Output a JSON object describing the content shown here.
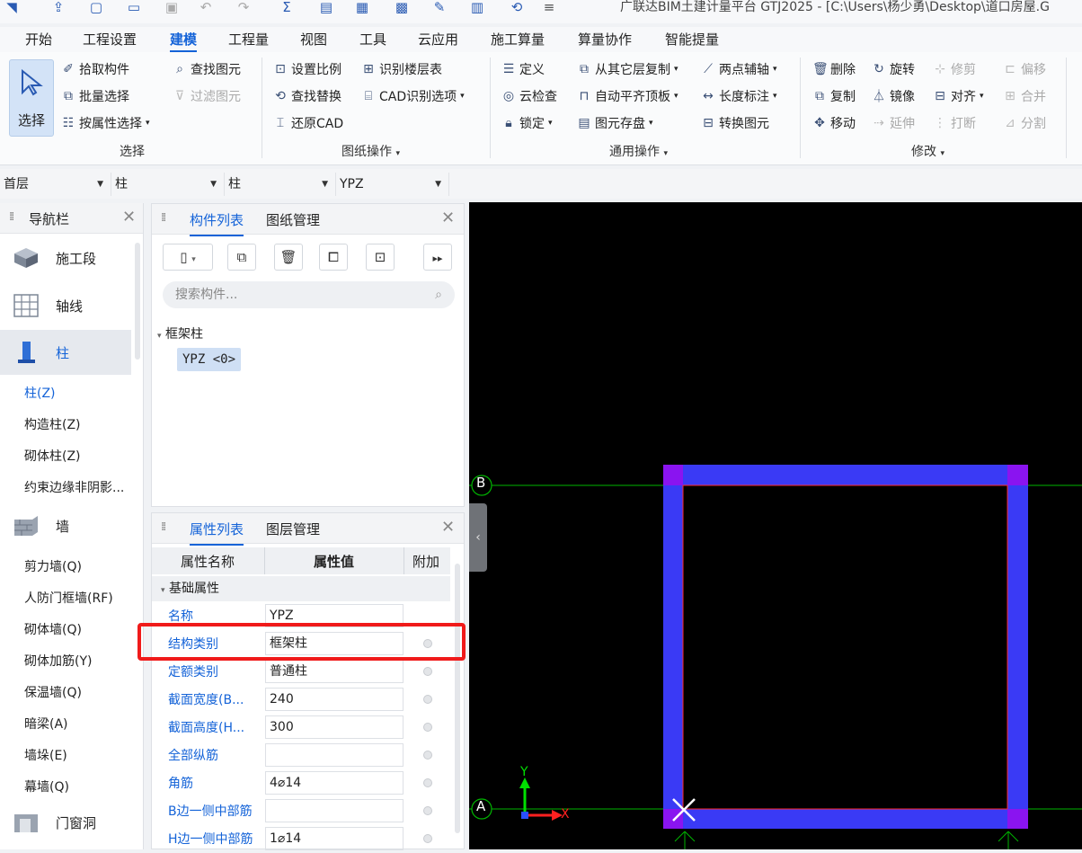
{
  "title_bar": {
    "title": "广联达BIM土建计量平台 GTJ2025 - [C:\\Users\\杨少勇\\Desktop\\道口房屋.G"
  },
  "tabs": [
    "开始",
    "工程设置",
    "建模",
    "工程量",
    "视图",
    "工具",
    "云应用",
    "施工算量",
    "算量协作",
    "智能提量"
  ],
  "ribbon": {
    "select_group": {
      "big_button": "选择",
      "pick": "拾取构件",
      "batch": "批量选择",
      "by_attr": "按属性选择",
      "find": "查找图元",
      "filter": "过滤图元",
      "label": "选择"
    },
    "drawing_group": {
      "set_scale": "设置比例",
      "floor_table": "识别楼层表",
      "find_replace": "查找替换",
      "cad_options": "CAD识别选项",
      "restore_cad": "还原CAD",
      "label": "图纸操作"
    },
    "common_group": {
      "define": "定义",
      "copy_from_layer": "从其它层复制",
      "two_point_axis": "两点辅轴",
      "cloud_check": "云检查",
      "auto_flush": "自动平齐顶板",
      "length_dim": "长度标注",
      "lock": "锁定",
      "save_elements": "图元存盘",
      "convert": "转换图元",
      "label": "通用操作"
    },
    "modify_group": {
      "delete": "删除",
      "rotate": "旋转",
      "trim": "修剪",
      "offset": "偏移",
      "copy": "复制",
      "mirror": "镜像",
      "align": "对齐",
      "merge": "合并",
      "move": "移动",
      "extend": "延伸",
      "break": "打断",
      "split": "分割",
      "label": "修改"
    }
  },
  "selectors": [
    "首层",
    "柱",
    "柱",
    "YPZ"
  ],
  "nav": {
    "title": "导航栏",
    "items": [
      {
        "type": "cat",
        "label": "施工段",
        "active": false
      },
      {
        "type": "cat",
        "label": "轴线",
        "active": false
      },
      {
        "type": "cat",
        "label": "柱",
        "active": true
      },
      {
        "type": "sub",
        "label": "柱(Z)",
        "active": true
      },
      {
        "type": "sub",
        "label": "构造柱(Z)"
      },
      {
        "type": "sub",
        "label": "砌体柱(Z)"
      },
      {
        "type": "sub",
        "label": "约束边缘非阴影..."
      },
      {
        "type": "cat",
        "label": "墙",
        "active": false
      },
      {
        "type": "sub",
        "label": "剪力墙(Q)"
      },
      {
        "type": "sub",
        "label": "人防门框墙(RF)"
      },
      {
        "type": "sub",
        "label": "砌体墙(Q)"
      },
      {
        "type": "sub",
        "label": "砌体加筋(Y)"
      },
      {
        "type": "sub",
        "label": "保温墙(Q)"
      },
      {
        "type": "sub",
        "label": "暗梁(A)"
      },
      {
        "type": "sub",
        "label": "墙垛(E)"
      },
      {
        "type": "sub",
        "label": "幕墙(Q)"
      },
      {
        "type": "cat",
        "label": "门窗洞",
        "active": false
      }
    ]
  },
  "component_panel": {
    "tabs": [
      "构件列表",
      "图纸管理"
    ],
    "search_placeholder": "搜索构件...",
    "tree_parent": "框架柱",
    "tree_item": "YPZ <0>"
  },
  "property_panel": {
    "tabs": [
      "属性列表",
      "图层管理"
    ],
    "headers": {
      "name": "属性名称",
      "value": "属性值",
      "extra": "附加"
    },
    "group": "基础属性",
    "rows": [
      {
        "name": "名称",
        "value": "YPZ",
        "dot": false
      },
      {
        "name": "结构类别",
        "value": "框架柱",
        "dot": true
      },
      {
        "name": "定额类别",
        "value": "普通柱",
        "dot": true
      },
      {
        "name": "截面宽度(B...",
        "value": "240",
        "dot": true
      },
      {
        "name": "截面高度(H...",
        "value": "300",
        "dot": true
      },
      {
        "name": "全部纵筋",
        "value": "",
        "dot": true
      },
      {
        "name": "角筋",
        "value": "4⌀14",
        "dot": true
      },
      {
        "name": "B边一侧中部筋",
        "value": "",
        "dot": true
      },
      {
        "name": "H边一侧中部筋",
        "value": "1⌀14",
        "dot": true
      }
    ]
  },
  "canvas": {
    "axis_b": "B",
    "axis_a": "A",
    "ucs_x": "X",
    "ucs_y": "Y",
    "colors": {
      "background": "#000000",
      "wall": "#3a3af5",
      "corner": "#8a14f0",
      "grid": "#00b400",
      "outline": "#ff2a2a"
    }
  }
}
